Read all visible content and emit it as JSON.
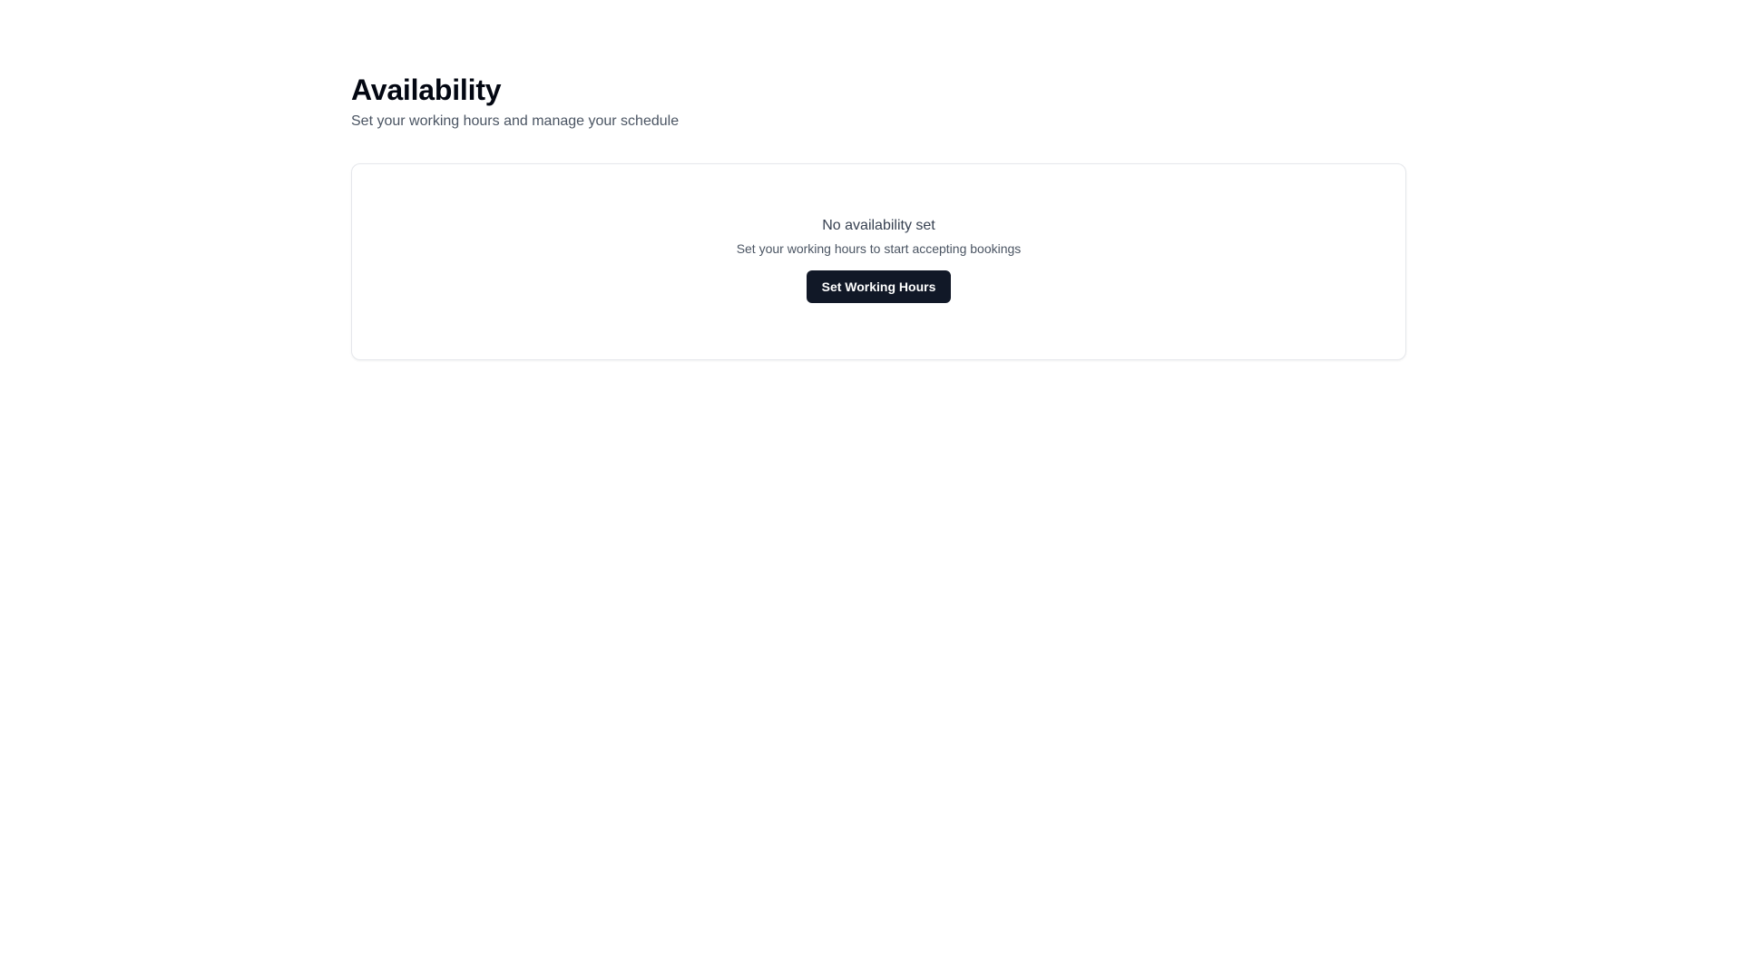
{
  "header": {
    "title": "Availability",
    "subtitle": "Set your working hours and manage your schedule"
  },
  "empty_state": {
    "title": "No availability set",
    "description": "Set your working hours to start accepting bookings",
    "button_label": "Set Working Hours"
  },
  "colors": {
    "button_background": "#111827",
    "button_text": "#ffffff",
    "card_border": "#e5e7eb",
    "subtitle_text": "#4b5563"
  }
}
